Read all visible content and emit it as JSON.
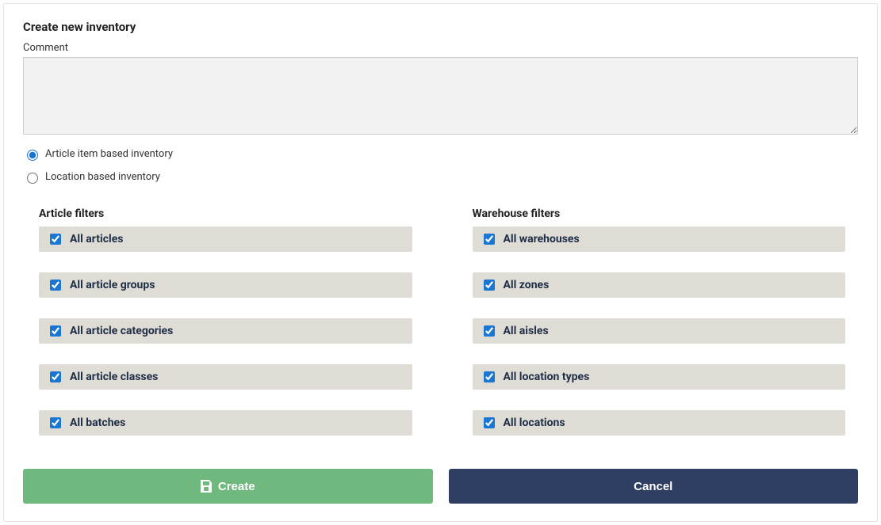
{
  "title": "Create new inventory",
  "comment": {
    "label": "Comment",
    "value": ""
  },
  "inventory_type": {
    "article_label": "Article item based inventory",
    "location_label": "Location based inventory",
    "selected": "article"
  },
  "article_filters": {
    "title": "Article filters",
    "items": [
      {
        "label": "All articles",
        "checked": true
      },
      {
        "label": "All article groups",
        "checked": true
      },
      {
        "label": "All article categories",
        "checked": true
      },
      {
        "label": "All article classes",
        "checked": true
      },
      {
        "label": "All batches",
        "checked": true
      }
    ]
  },
  "warehouse_filters": {
    "title": "Warehouse filters",
    "items": [
      {
        "label": "All warehouses",
        "checked": true
      },
      {
        "label": "All zones",
        "checked": true
      },
      {
        "label": "All aisles",
        "checked": true
      },
      {
        "label": "All location types",
        "checked": true
      },
      {
        "label": "All locations",
        "checked": true
      }
    ]
  },
  "buttons": {
    "create": "Create",
    "cancel": "Cancel"
  }
}
